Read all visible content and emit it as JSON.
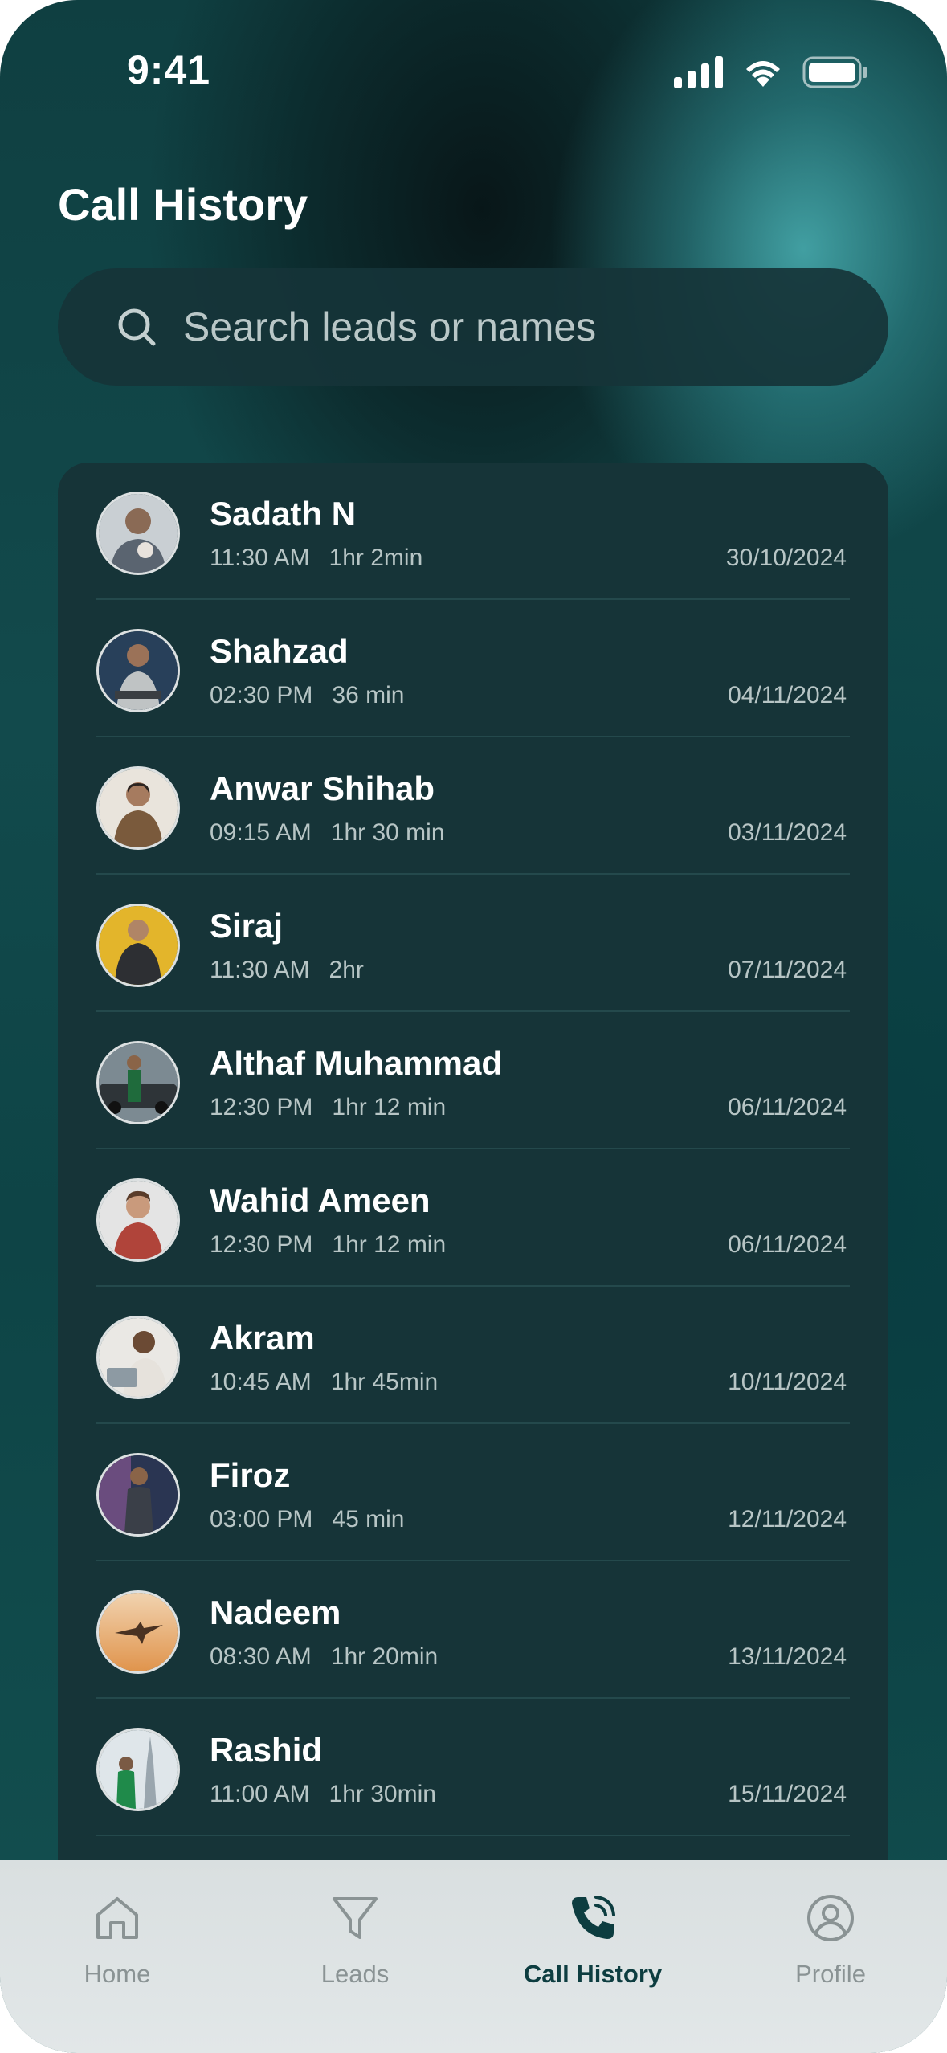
{
  "status_bar": {
    "time": "9:41"
  },
  "header": {
    "title": "Call History"
  },
  "search": {
    "placeholder": "Search leads or names"
  },
  "calls": [
    {
      "name": "Sadath N",
      "time": "11:30 AM",
      "duration": "1hr 2min",
      "date": "30/10/2024"
    },
    {
      "name": "Shahzad",
      "time": "02:30 PM",
      "duration": "36 min",
      "date": "04/11/2024"
    },
    {
      "name": "Anwar Shihab",
      "time": "09:15 AM",
      "duration": "1hr 30 min",
      "date": "03/11/2024"
    },
    {
      "name": "Siraj",
      "time": "11:30 AM",
      "duration": "2hr",
      "date": "07/11/2024"
    },
    {
      "name": "Althaf Muhammad",
      "time": "12:30 PM",
      "duration": "1hr 12 min",
      "date": "06/11/2024"
    },
    {
      "name": "Wahid Ameen",
      "time": "12:30 PM",
      "duration": "1hr 12 min",
      "date": "06/11/2024"
    },
    {
      "name": "Akram",
      "time": "10:45 AM",
      "duration": "1hr 45min",
      "date": "10/11/2024"
    },
    {
      "name": "Firoz",
      "time": "03:00 PM",
      "duration": "45 min",
      "date": "12/11/2024"
    },
    {
      "name": "Nadeem",
      "time": "08:30 AM",
      "duration": "1hr 20min",
      "date": "13/11/2024"
    },
    {
      "name": "Rashid",
      "time": "11:00 AM",
      "duration": "1hr 30min",
      "date": "15/11/2024"
    }
  ],
  "tabs": [
    {
      "label": "Home",
      "icon": "home-icon",
      "active": false
    },
    {
      "label": "Leads",
      "icon": "filter-icon",
      "active": false
    },
    {
      "label": "Call History",
      "icon": "phone-call-icon",
      "active": true
    },
    {
      "label": "Profile",
      "icon": "user-circle-icon",
      "active": false
    }
  ],
  "colors": {
    "accent": "#0d3d40",
    "card": "#163438",
    "text_secondary": "#b7c5c5",
    "tab_inactive": "#8a9394"
  }
}
